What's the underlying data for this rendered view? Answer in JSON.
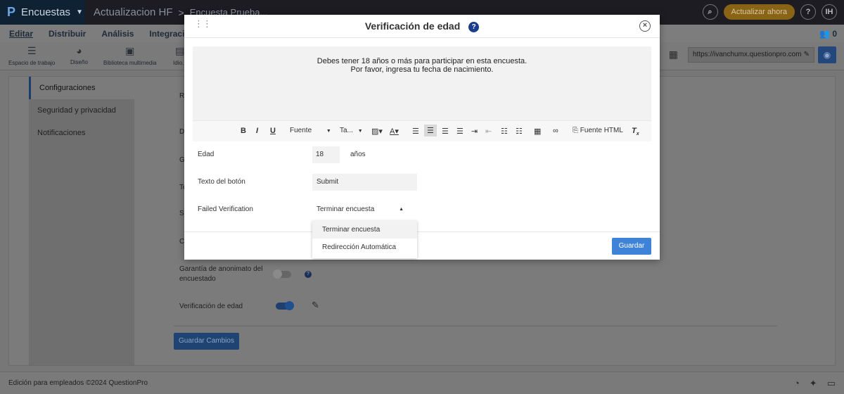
{
  "topbar": {
    "logo": "P",
    "app_name": "Encuestas",
    "breadcrumb_project": "Actualizacion HF",
    "breadcrumb_sep": ">",
    "breadcrumb_survey": "Encuesta Prueba...",
    "upgrade_label": "Actualizar ahora",
    "help_label": "?",
    "user_initials": "IH"
  },
  "menu": {
    "items": [
      "Editar",
      "Distribuir",
      "Análisis",
      "Integración"
    ],
    "collab_count": "0"
  },
  "toolbar": {
    "items": [
      "Espacio de trabajo",
      "Diseño",
      "Biblioteca multimedia",
      "Idio..."
    ],
    "url": "https://ivanchumx.questionpro.com"
  },
  "sidebar": {
    "items": [
      "Configuraciones",
      "Seguridad y privacidad",
      "Notificaciones"
    ]
  },
  "settings": {
    "partial_labels": [
      "Re",
      "De",
      "Ga",
      "Te",
      "SE",
      "Ca"
    ],
    "anonymity_label_line1": "Garantía de anonimato del",
    "anonymity_label_line2": "encuestado",
    "age_verification_label": "Verificación de edad",
    "save_changes_label": "Guardar Cambios"
  },
  "footer": {
    "text": "Edición para empleados ©2024 QuestionPro"
  },
  "modal": {
    "title": "Verificación de edad",
    "help_icon_label": "?",
    "editor_line1": "Debes tener 18 años o más para participar en esta encuesta.",
    "editor_line2": "Por favor, ingresa tu fecha de nacimiento.",
    "editor_toolbar": {
      "bold": "B",
      "italic": "I",
      "underline": "U",
      "font": "Fuente",
      "size": "Ta...",
      "html_source": "Fuente HTML"
    },
    "age_label": "Edad",
    "age_value": "18",
    "age_unit": "años",
    "button_text_label": "Texto del botón",
    "button_text_value": "Submit",
    "failed_label": "Failed Verification",
    "failed_selected": "Terminar encuesta",
    "failed_options": [
      "Terminar encuesta",
      "Redirección Automática"
    ],
    "save_label": "Guardar"
  }
}
